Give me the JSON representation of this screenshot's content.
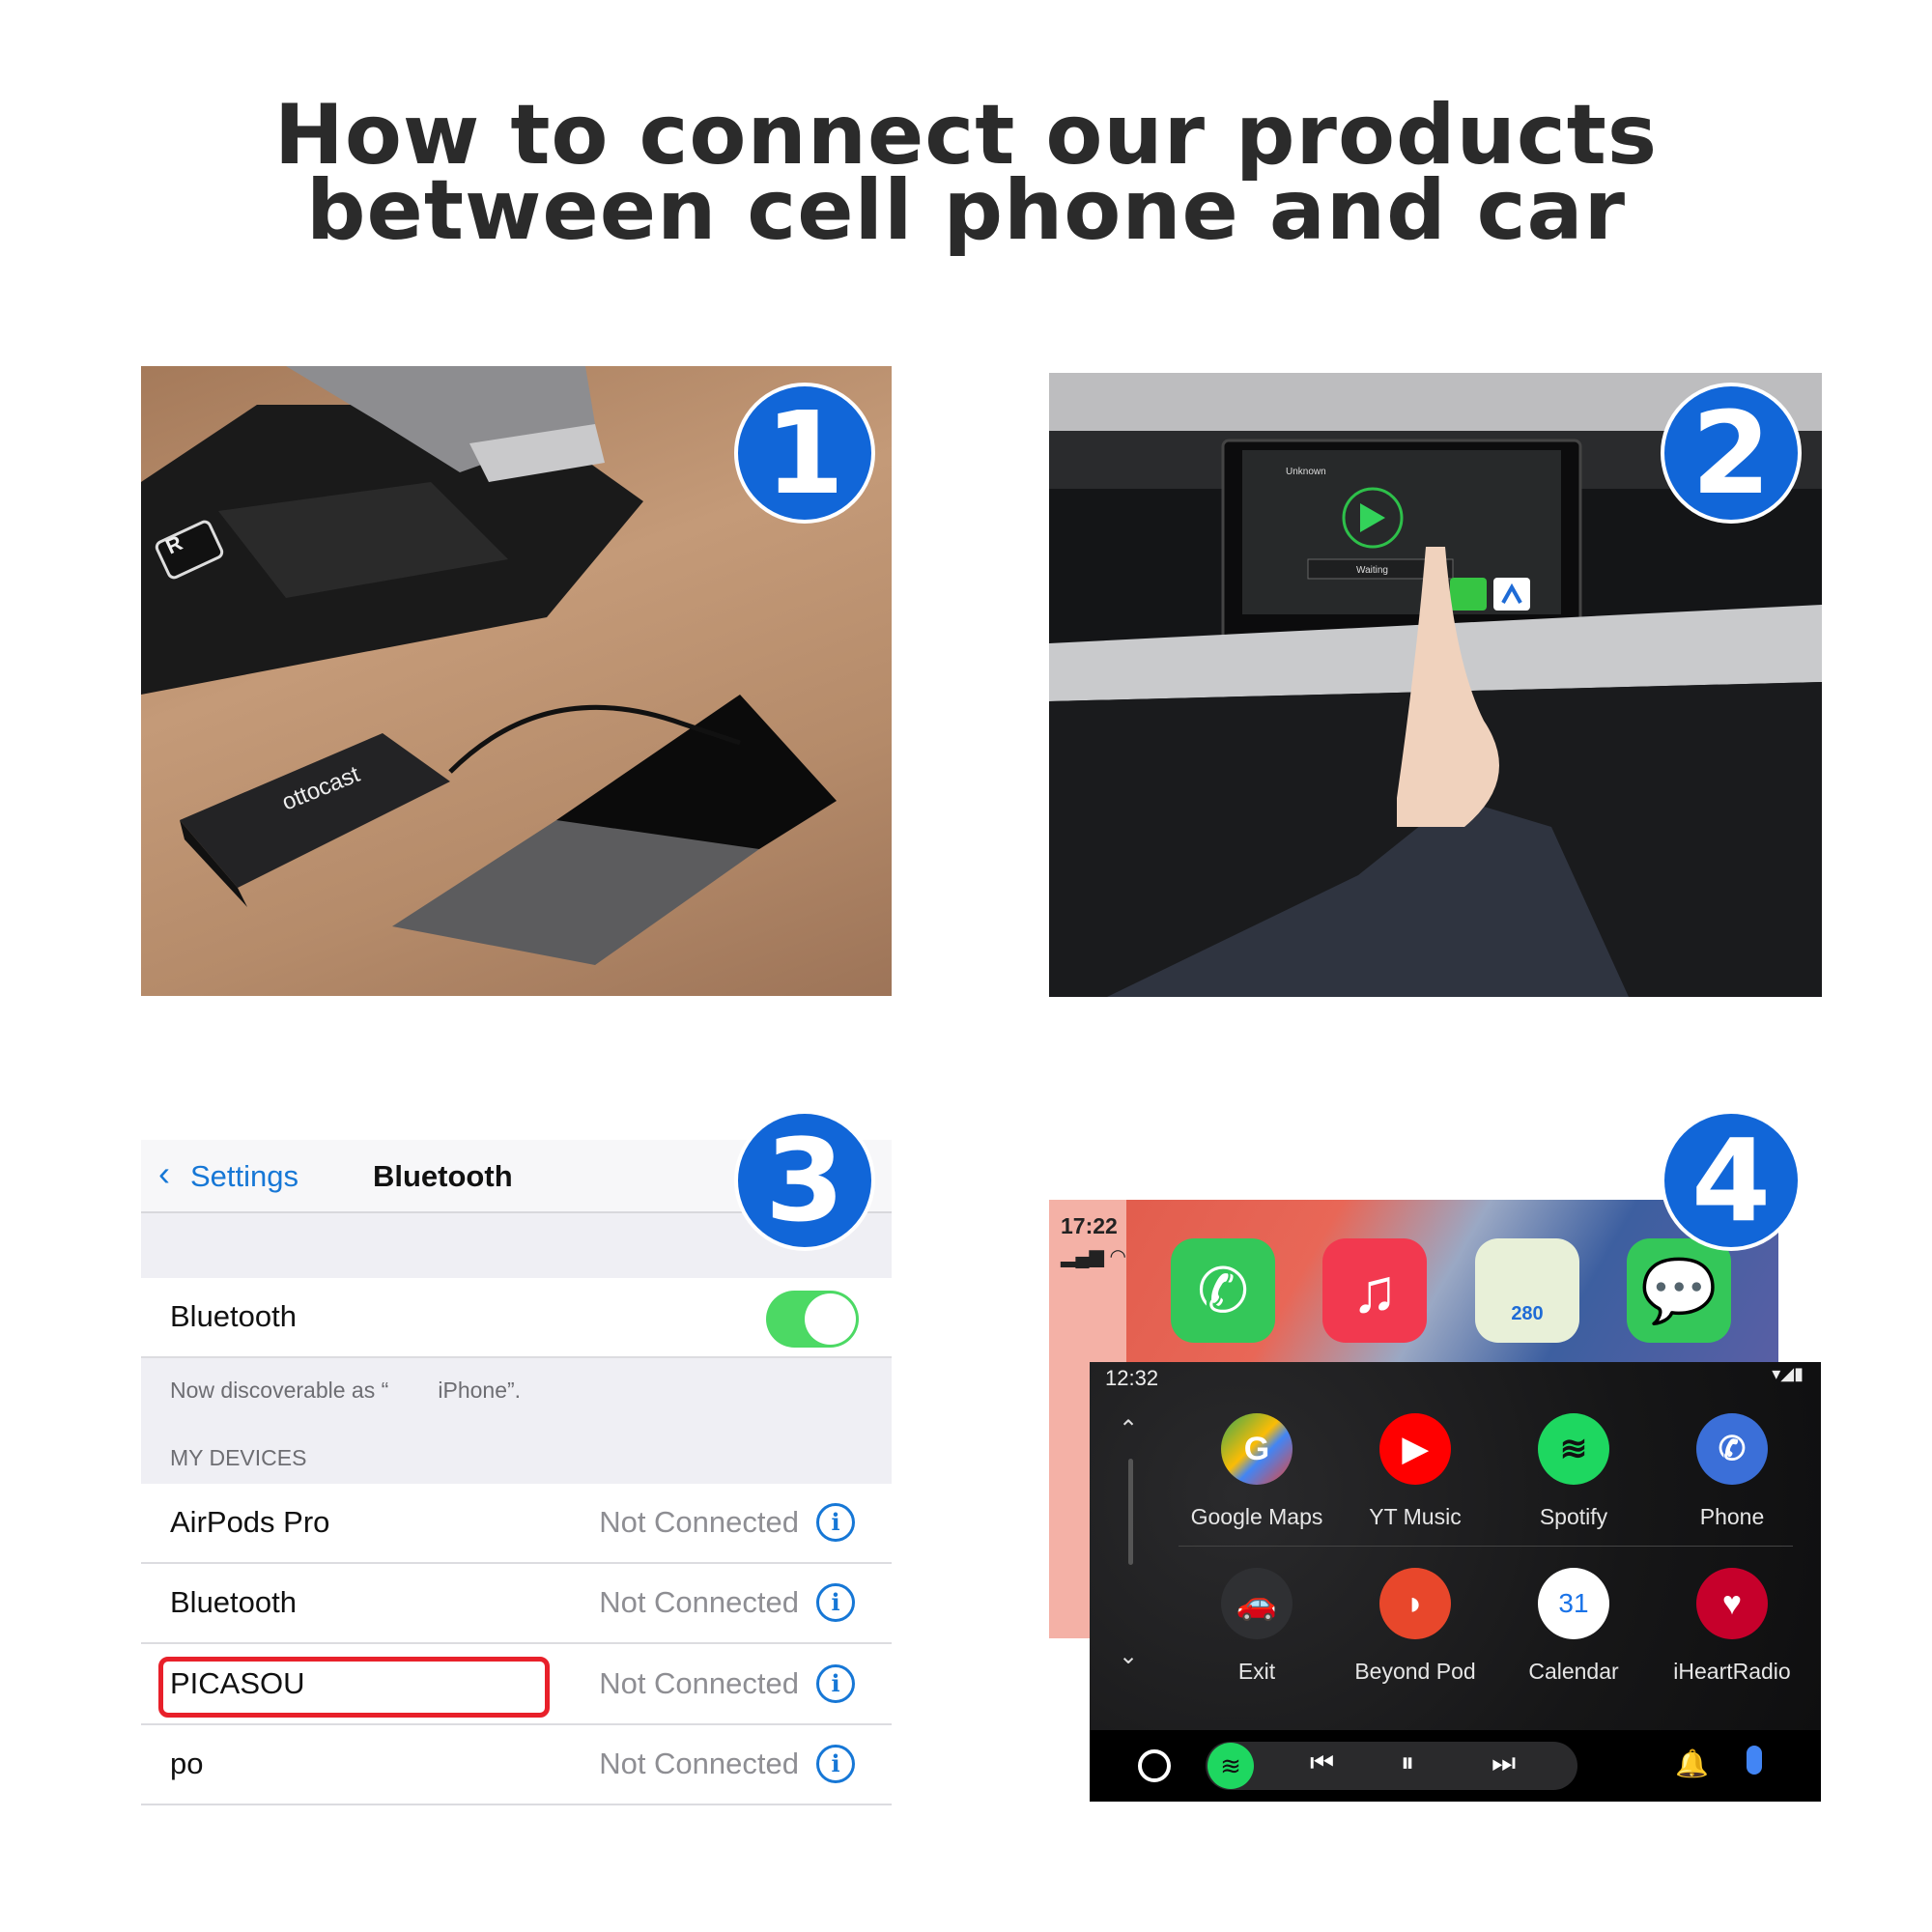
{
  "title": {
    "line1": "How to connect our products",
    "line2": "between cell phone and car"
  },
  "badges": [
    "1",
    "2",
    "3",
    "4"
  ],
  "step1": {
    "logo": "ottocast",
    "gear_label": "R"
  },
  "step2": {
    "bt_device": "Unknown",
    "status": "Waiting"
  },
  "step3": {
    "back_label": "Settings",
    "header_title": "Bluetooth",
    "toggle_label": "Bluetooth",
    "toggle_on": true,
    "discoverable_text": "Now discoverable as “        iPhone”.",
    "section_header": "MY DEVICES",
    "devices": [
      {
        "name": "AirPods Pro",
        "status": "Not Connected"
      },
      {
        "name": "Bluetooth",
        "status": "Not Connected"
      },
      {
        "name": "PICASOU",
        "status": "Not Connected",
        "highlighted": true
      },
      {
        "name": "po",
        "status": "Not Connected"
      }
    ],
    "info_glyph": "i",
    "accent": "#1677d6",
    "toggle_color": "#4cd964",
    "highlight_color": "#e8202a"
  },
  "step4": {
    "carplay": {
      "time": "17:22",
      "apps": [
        "phone-icon",
        "music-icon",
        "maps-icon",
        "messages-icon"
      ],
      "map_shield": "280"
    },
    "android_auto": {
      "time": "12:32",
      "apps": [
        {
          "label": "Google Maps",
          "icon": "google-maps-icon",
          "color": "#4285f4"
        },
        {
          "label": "YT Music",
          "icon": "yt-music-icon",
          "color": "#ff0000"
        },
        {
          "label": "Spotify",
          "icon": "spotify-icon",
          "color": "#1ed760"
        },
        {
          "label": "Phone",
          "icon": "phone-icon",
          "color": "#3b6fd8"
        },
        {
          "label": "Exit",
          "icon": "car-icon",
          "color": "#2f3033"
        },
        {
          "label": "Beyond Pod",
          "icon": "beyond-pod-icon",
          "color": "#e8472b"
        },
        {
          "label": "Calendar",
          "icon": "calendar-icon",
          "color": "#ffffff",
          "day": "31"
        },
        {
          "label": "iHeartRadio",
          "icon": "iheartradio-icon",
          "color": "#c6002b"
        }
      ]
    }
  }
}
